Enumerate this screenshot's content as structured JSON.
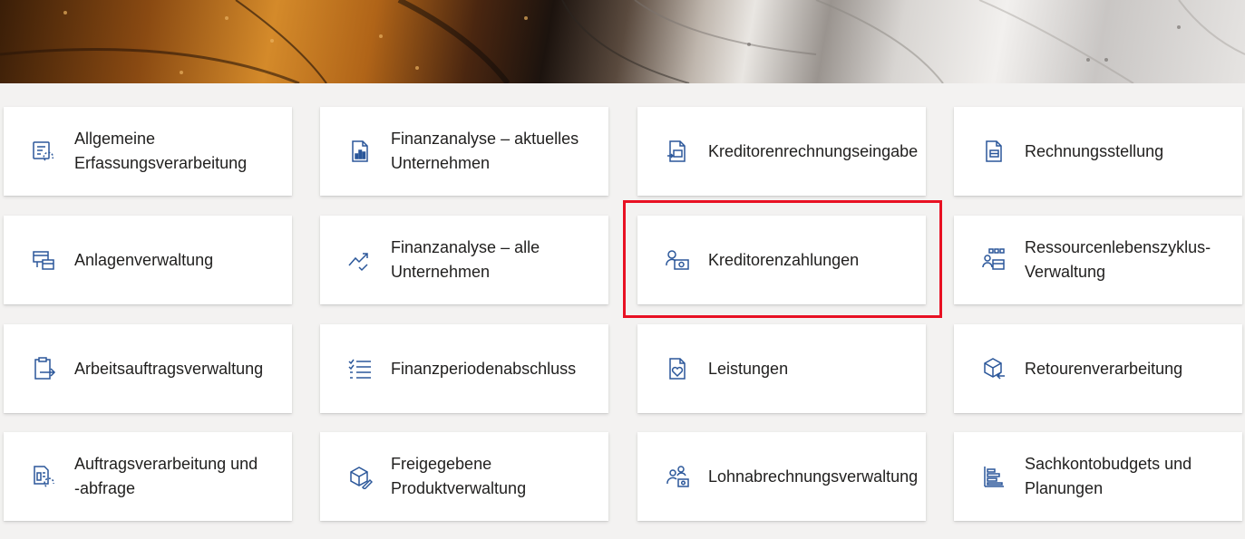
{
  "banner": {
    "description_icon": "metal-banner"
  },
  "colors": {
    "accent": "#2b579a",
    "highlight": "#e81123",
    "background": "#f3f2f1",
    "tile": "#ffffff"
  },
  "tiles": [
    {
      "label": "Allgemeine\nErfassungsverarbeitung",
      "icon": "journal-sync-icon"
    },
    {
      "label": "Finanzanalyse – aktuelles\nUnternehmen",
      "icon": "report-chart-icon"
    },
    {
      "label": "Kreditorenrechnungseingabe",
      "icon": "invoice-entry-icon"
    },
    {
      "label": "Rechnungsstellung",
      "icon": "invoice-icon"
    },
    {
      "label": "Anlagenverwaltung",
      "icon": "asset-management-icon"
    },
    {
      "label": "Finanzanalyse – alle\nUnternehmen",
      "icon": "trend-check-icon"
    },
    {
      "label": "Kreditorenzahlungen",
      "icon": "vendor-payment-icon"
    },
    {
      "label": "Ressourcenlebenszyklus-\nVerwaltung",
      "icon": "resource-lifecycle-icon"
    },
    {
      "label": "Arbeitsauftragsverwaltung",
      "icon": "clipboard-arrow-icon"
    },
    {
      "label": "Finanzperiodenabschluss",
      "icon": "checklist-icon"
    },
    {
      "label": "Leistungen",
      "icon": "benefits-heart-icon"
    },
    {
      "label": "Retourenverarbeitung",
      "icon": "return-box-icon"
    },
    {
      "label": "Auftragsverarbeitung und\n-abfrage",
      "icon": "order-sync-icon"
    },
    {
      "label": "Freigegebene\nProduktverwaltung",
      "icon": "product-box-icon"
    },
    {
      "label": "Lohnabrechnungsverwaltung",
      "icon": "payroll-people-icon"
    },
    {
      "label": "Sachkontobudgets und\nPlanungen",
      "icon": "budget-bars-icon"
    }
  ]
}
